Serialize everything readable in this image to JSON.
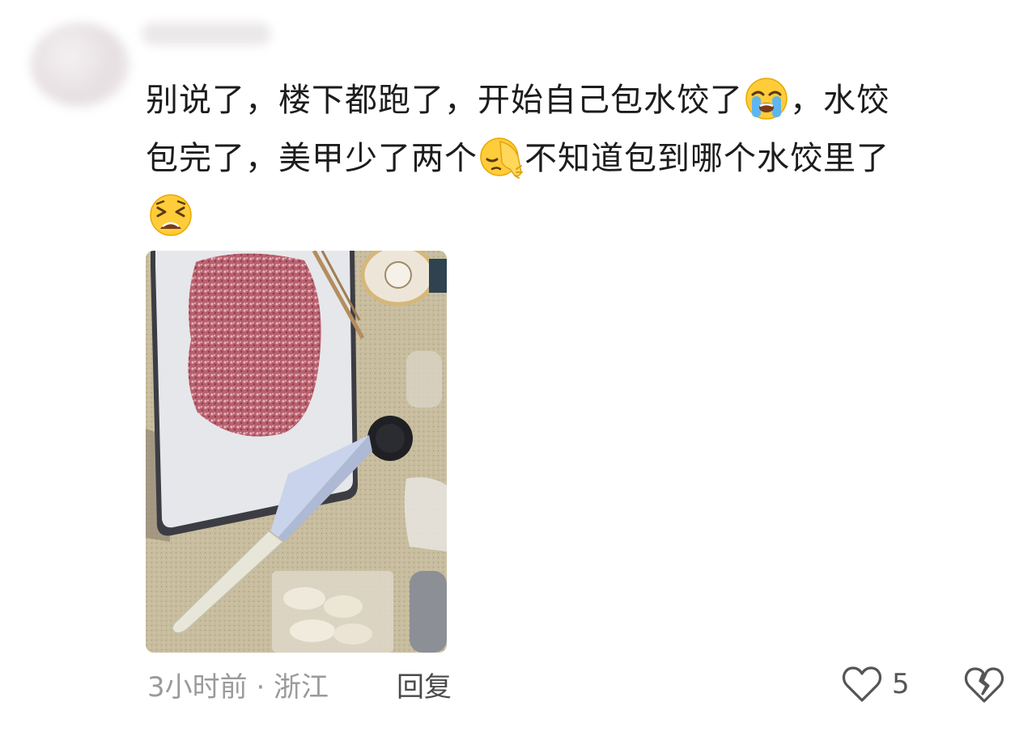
{
  "comment": {
    "author_name": "",
    "text_lines": [
      [
        "别说了，楼下都跑了，开始自己包水饺了",
        "emoji:loudly-crying",
        "，水饺"
      ],
      [
        "包完了，美甲少了两个",
        "emoji:face-palm",
        "不知道包到哪个水饺里了"
      ],
      [
        "emoji:tired-face"
      ]
    ],
    "line1_a": "别说了，楼下都跑了，开始自己包水饺了",
    "line1_b": "，水饺",
    "line2_a": "包完了，美甲少了两个",
    "line2_b": "不知道包到哪个水饺里了",
    "emojis": [
      "loudly-crying-face",
      "face-palm",
      "tired-face"
    ],
    "photo_icon": "photo-minced-meat-dumplings",
    "meta": "3小时前 · 浙江",
    "reply_label": "回复",
    "like_count": "5"
  },
  "colors": {
    "text": "#1c1c1c",
    "meta": "#9a9a9a",
    "reply": "#4a4a4a",
    "icon": "#555555"
  }
}
